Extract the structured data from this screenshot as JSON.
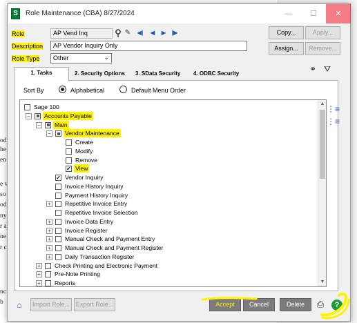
{
  "window": {
    "title": "Role Maintenance (CBA) 8/27/2024",
    "app_icon": "S",
    "min_icon": "—",
    "max_icon": "☐",
    "close_icon": "✕"
  },
  "header": {
    "role_label": "Role",
    "role_value": "AP Vend Inq",
    "description_label": "Description",
    "description_value": "AP Vendor Inquiry Only",
    "role_type_label": "Role Type",
    "role_type_value": "Other",
    "nav_first": "◀|",
    "nav_prev": "◀",
    "nav_next": "▶",
    "nav_last": "|▶"
  },
  "buttons": {
    "copy": "Copy...",
    "apply": "Apply...",
    "assign": "Assign...",
    "remove": "Remove...",
    "import_role": "Import Role...",
    "export_role": "Export Role...",
    "accept": "Accept",
    "cancel": "Cancel",
    "delete": "Delete"
  },
  "tabs": [
    {
      "label": "1. Tasks"
    },
    {
      "label": "2. Security Options"
    },
    {
      "label": "3. SData Security"
    },
    {
      "label": "4. ODBC Security"
    }
  ],
  "sort": {
    "label": "Sort By",
    "option1": "Alphabetical",
    "option2": "Default Menu Order",
    "selected": "Alphabetical"
  },
  "tree": {
    "items": [
      {
        "label": "Sage 100",
        "state": "unchecked",
        "expander": ""
      },
      {
        "label": "Accounts Payable",
        "state": "partial",
        "expander": "−"
      },
      {
        "label": "Main",
        "state": "partial",
        "expander": "−"
      },
      {
        "label": "Vendor Maintenance",
        "state": "partial",
        "expander": "−"
      },
      {
        "label": "Create",
        "state": "unchecked",
        "expander": ""
      },
      {
        "label": "Modify",
        "state": "unchecked",
        "expander": ""
      },
      {
        "label": "Remove",
        "state": "unchecked",
        "expander": ""
      },
      {
        "label": "View",
        "state": "checked",
        "expander": ""
      },
      {
        "label": "Vendor Inquiry",
        "state": "checked",
        "expander": ""
      },
      {
        "label": "Invoice History Inquiry",
        "state": "unchecked",
        "expander": ""
      },
      {
        "label": "Payment History Inquiry",
        "state": "unchecked",
        "expander": ""
      },
      {
        "label": "Repetitive Invoice Entry",
        "state": "unchecked",
        "expander": "+"
      },
      {
        "label": "Repetitive Invoice Selection",
        "state": "unchecked",
        "expander": ""
      },
      {
        "label": "Invoice Data Entry",
        "state": "unchecked",
        "expander": "+"
      },
      {
        "label": "Invoice Register",
        "state": "unchecked",
        "expander": "+"
      },
      {
        "label": "Manual Check and Payment Entry",
        "state": "unchecked",
        "expander": "+"
      },
      {
        "label": "Manual Check and Payment Register",
        "state": "unchecked",
        "expander": "+"
      },
      {
        "label": "Daily Transaction Register",
        "state": "unchecked",
        "expander": "+"
      },
      {
        "label": "Check Printing and Electronic Payment",
        "state": "unchecked",
        "expander": "+"
      },
      {
        "label": "Pre-Note Printing",
        "state": "unchecked",
        "expander": "+"
      },
      {
        "label": "Reports",
        "state": "unchecked",
        "expander": "+"
      }
    ]
  },
  "background_doc": {
    "fragments": [
      "od",
      "he",
      "en",
      "e v",
      "so",
      "od",
      "ny",
      "r a",
      "ne",
      "r c",
      "nc",
      "b"
    ]
  },
  "colors": {
    "highlight": "#fff200",
    "titlebar_close": "#e81123",
    "help_green": "#1f9a3c"
  },
  "icons": {
    "search": "⚲",
    "binoculars": "⚭",
    "filter": "⛛",
    "printer": "⎙",
    "help": "?",
    "graduation_cap": "🎓"
  }
}
